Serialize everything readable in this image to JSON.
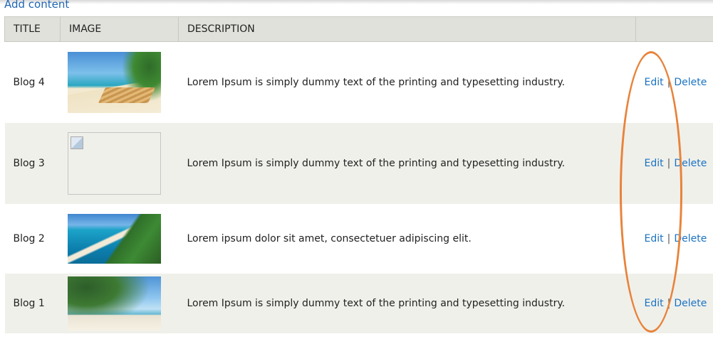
{
  "header_link": "Add content",
  "columns": [
    "TITLE",
    "IMAGE",
    "DESCRIPTION",
    ""
  ],
  "rows": [
    {
      "title": "Blog 4",
      "image": "beach-chairs-photo",
      "description": "Lorem Ipsum is simply dummy text of the printing and typesetting industry.",
      "edit": "Edit",
      "separator": "|",
      "delete": "Delete"
    },
    {
      "title": "Blog 3",
      "image": "broken-image",
      "description": "Lorem Ipsum is simply dummy text of the printing and typesetting industry.",
      "edit": "Edit",
      "separator": "|",
      "delete": "Delete"
    },
    {
      "title": "Blog 2",
      "image": "tropical-coast-photo",
      "description": "Lorem ipsum dolor sit amet, consectetuer adipiscing elit.",
      "edit": "Edit",
      "separator": "|",
      "delete": "Delete"
    },
    {
      "title": "Blog 1",
      "image": "palm-beach-photo",
      "description": "Lorem Ipsum is simply dummy text of the printing and typesetting industry.",
      "edit": "Edit",
      "separator": "|",
      "delete": "Delete"
    }
  ],
  "colors": {
    "link": "#1a73c2",
    "header_bg": "#e1e1dc",
    "stripe_bg": "#f0f0eb",
    "annotation": "#e8833a"
  }
}
